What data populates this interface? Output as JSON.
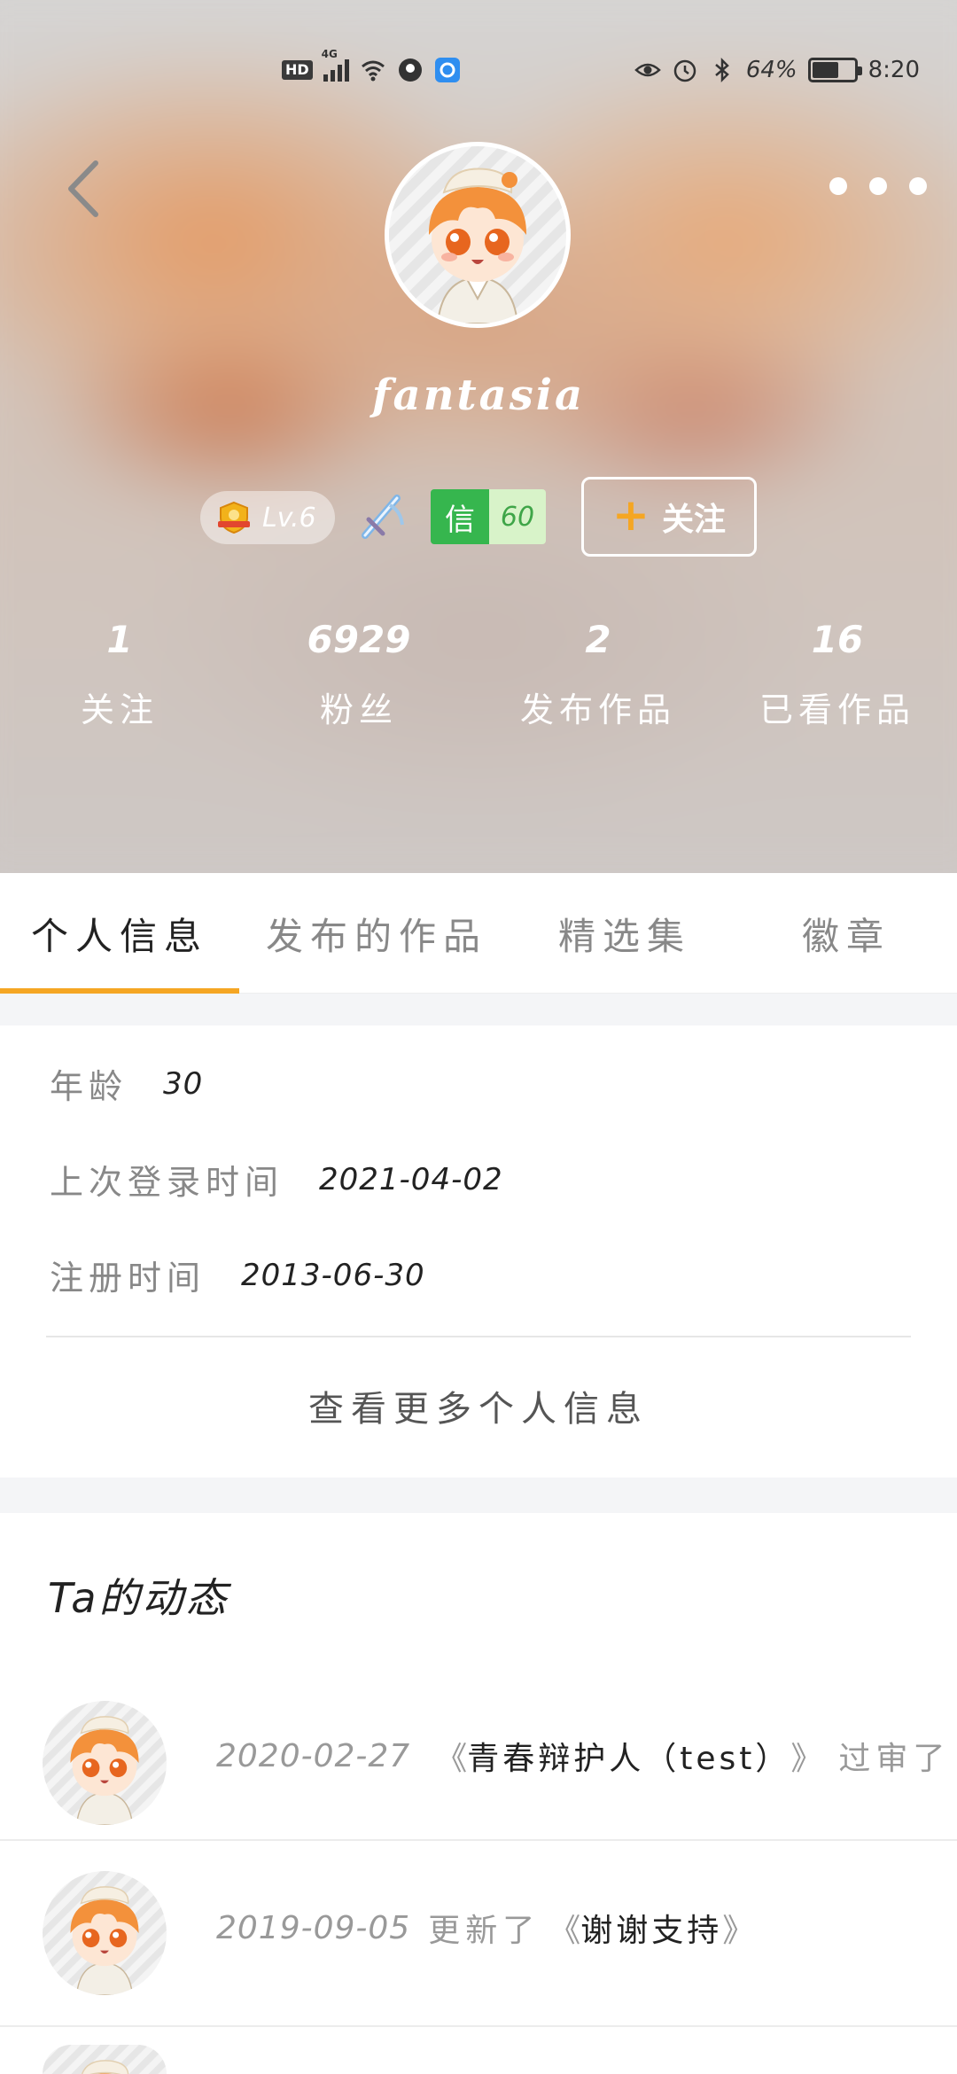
{
  "status_bar": {
    "hd": "HD",
    "network": "4G",
    "battery_pct": "64%",
    "battery_level": 0.64,
    "time": "8:20"
  },
  "profile": {
    "username": "fantasia",
    "level_label": "Lv.6",
    "credit_label": "信",
    "credit_score": "60",
    "follow_label": "关注",
    "follow_plus": "+",
    "stats": [
      {
        "value": "1",
        "label": "关注"
      },
      {
        "value": "6929",
        "label": "粉丝"
      },
      {
        "value": "2",
        "label": "发布作品"
      },
      {
        "value": "16",
        "label": "已看作品"
      }
    ]
  },
  "tabs": [
    {
      "label": "个人信息",
      "active": true
    },
    {
      "label": "发布的作品",
      "active": false
    },
    {
      "label": "精选集",
      "active": false
    },
    {
      "label": "徽章",
      "active": false
    }
  ],
  "info": {
    "age_label": "年龄",
    "age_value": "30",
    "last_login_label": "上次登录时间",
    "last_login_value": "2021-04-02",
    "register_label": "注册时间",
    "register_value": "2013-06-30",
    "more_label": "查看更多个人信息"
  },
  "activity": {
    "title": "Ta的动态",
    "items": [
      {
        "date": "2020-02-27",
        "open": "《",
        "work": "青春辩护人（test）",
        "close": "》",
        "action": "过审了"
      },
      {
        "date": "2019-09-05",
        "action": "更新了",
        "open": "《",
        "work": "谢谢支持",
        "close": "》"
      }
    ]
  },
  "colors": {
    "accent": "#f5a623",
    "credit_green": "#36b64e",
    "credit_light": "#d8f3c9"
  },
  "icons": [
    "back-icon",
    "more-icon",
    "level-shield-icon",
    "sword-badge-icon",
    "plus-icon"
  ]
}
